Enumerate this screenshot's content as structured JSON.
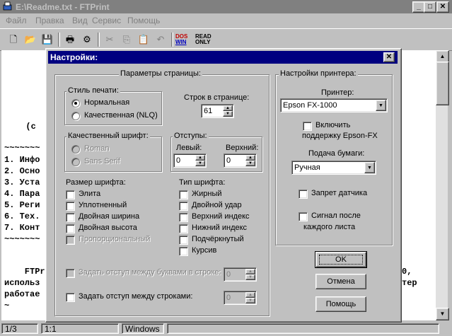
{
  "window": {
    "title": "E:\\Readme.txt - FTPrint"
  },
  "menu": [
    "Файл",
    "Правка",
    "Вид",
    "Сервис",
    "Помощь"
  ],
  "toolbar": {
    "dos_win": [
      "DOS",
      "WIN"
    ],
    "read_only": [
      "READ",
      "ONLY"
    ]
  },
  "document": {
    "lines": [
      "  (с",
      "~~~~~~~",
      "1. Инфо",
      "2. Осно",
      "3. Уста",
      "4. Пара",
      "5. Реги",
      "6. Тех.",
      "7. Конт",
      "~~~~~~~",
      "    FTPr",
      "использ",
      "работае",
      "~"
    ],
    "right_lines": [
      "0,",
      "тер"
    ]
  },
  "status": {
    "page": "1/3",
    "zoom": "1:1",
    "encoding": "Windows"
  },
  "dialog": {
    "title": "Настройки:",
    "page_params": {
      "title": "Параметры страницы:",
      "print_style": {
        "title": "Стиль печати:",
        "options": [
          "Нормальная",
          "Качественная (NLQ)"
        ],
        "selected": 0
      },
      "lines_per_page": {
        "label": "Строк в странице:",
        "value": "61"
      },
      "quality_font": {
        "title": "Качественный шрифт:",
        "options": [
          "Roman",
          "Sans Serif"
        ]
      },
      "margins": {
        "title": "Отступы:",
        "left_label": "Левый:",
        "left_value": "0",
        "top_label": "Верхний:",
        "top_value": "0"
      },
      "font_size": {
        "title": "Размер шрифта:",
        "options": [
          "Элита",
          "Уплотненный",
          "Двойная ширина",
          "Двойная высота",
          "Пропорциональный"
        ]
      },
      "font_type": {
        "title": "Тип шрифта:",
        "options": [
          "Жирный",
          "Двойной удар",
          "Верхний индекс",
          "Нижний индекс",
          "Подчёркнутый",
          "Курсив"
        ]
      },
      "char_spacing": {
        "label": "Задать отступ между буквами в строке:",
        "value": "0"
      },
      "line_spacing": {
        "label": "Задать отступ между строками:",
        "value": "0"
      }
    },
    "printer": {
      "title": "Настройки принтера:",
      "printer_label": "Принтер:",
      "printer_value": "Epson FX-1000",
      "epson_fx": [
        "Включить",
        "поддержку Epson-FX"
      ],
      "paper_feed_label": "Подача бумаги:",
      "paper_feed_value": "Ручная",
      "sensor_label": "Запрет датчика",
      "signal": [
        "Сигнал после",
        "каждого листа"
      ]
    },
    "buttons": {
      "ok": "OK",
      "cancel": "Отмена",
      "help": "Помощь"
    }
  }
}
